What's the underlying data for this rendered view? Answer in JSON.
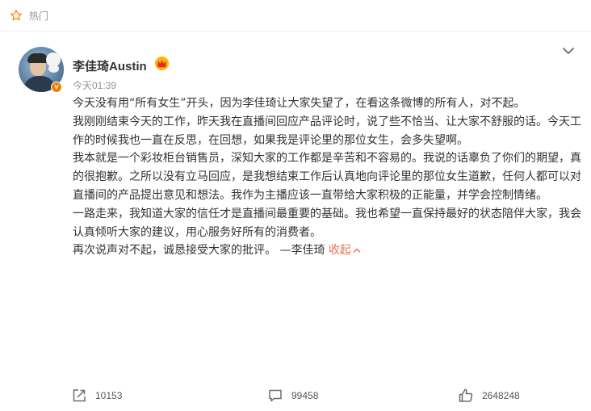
{
  "topbar": {
    "label": "热门",
    "icon": "star-outline-icon"
  },
  "post": {
    "username": "李佳琦Austin",
    "time": "今天01:39",
    "verified_badge": "v",
    "paragraphs": [
      "今天没有用“所有女生”开头，因为李佳琦让大家失望了，在看这条微博的所有人，对不起。",
      "我刚刚结束今天的工作，昨天我在直播间回应产品评论时，说了些不恰当、让大家不舒服的话。今天工作的时候我也一直在反思，在回想，如果我是评论里的那位女生，会多失望啊。",
      "我本就是一个彩妆柜台销售员，深知大家的工作都是辛苦和不容易的。我说的话辜负了你们的期望，真的很抱歉。之所以没有立马回应，是我想结束工作后认真地向评论里的那位女生道歉，任何人都可以对直播间的产品提出意见和想法。我作为主播应该一直带给大家积极的正能量，并学会控制情绪。",
      "一路走来，我知道大家的信任才是直播间最重要的基础。我也希望一直保持最好的状态陪伴大家，我会认真倾听大家的建议，用心服务好所有的消费者。"
    ],
    "last_line": "再次说声对不起，诚恳接受大家的批评。 —李佳琦 ",
    "collapse_label": "收起"
  },
  "actions": {
    "repost_count": "10153",
    "comment_count": "99458",
    "like_count": "2648248"
  },
  "colors": {
    "accent": "#eb7350",
    "muted": "#939393",
    "text": "#333333"
  }
}
